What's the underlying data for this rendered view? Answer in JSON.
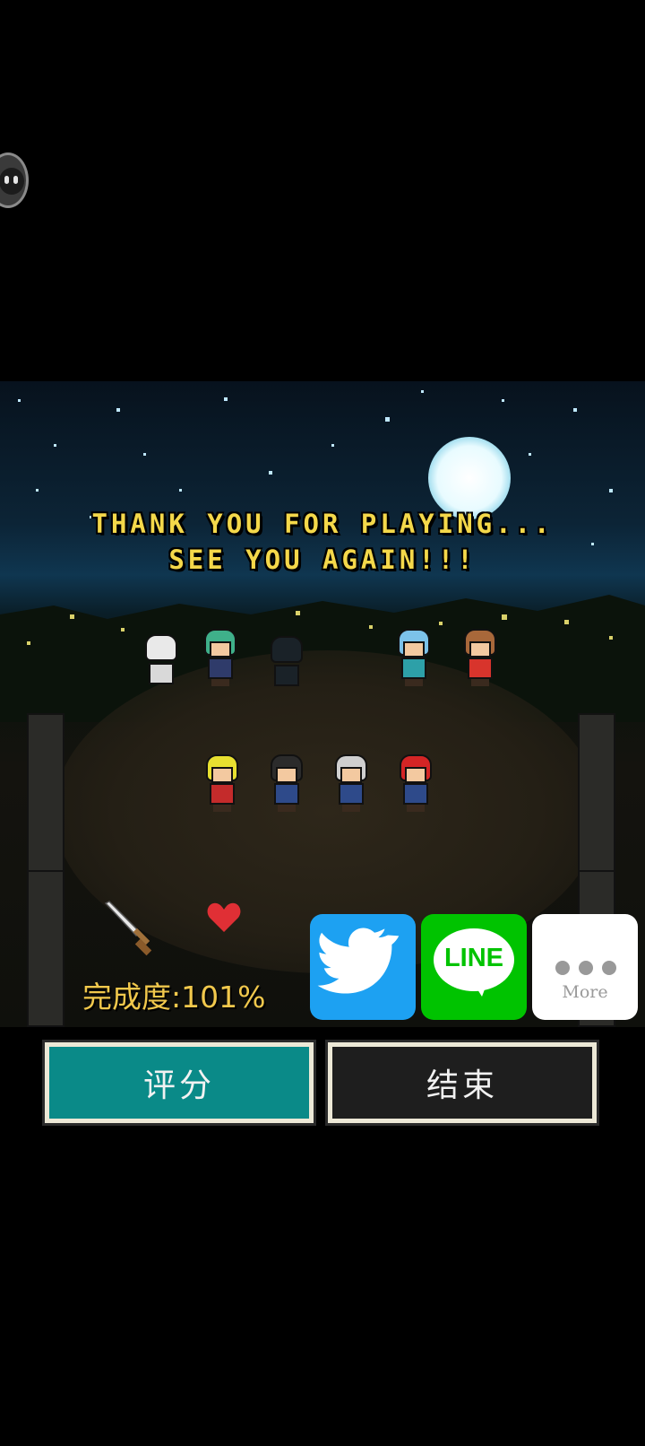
{
  "overlay": {
    "assistant_icon": "assistant-ball-icon"
  },
  "scene": {
    "message_line1": "THANK YOU FOR PLAYING...",
    "message_line2": "SEE YOU AGAIN!!!",
    "progress_text": "完成度:101%",
    "icons": [
      "sword-icon",
      "heart-icon",
      "moon-icon"
    ]
  },
  "share": {
    "twitter_icon": "twitter-bird-icon",
    "line_label": "LINE",
    "more_label": "More"
  },
  "buttons": {
    "rate_label": "评分",
    "end_label": "结束"
  },
  "colors": {
    "title_yellow": "#f4d84a",
    "rate_teal": "#0a8a88",
    "end_dark": "#1e1e1e",
    "twitter_blue": "#1da1f2",
    "line_green": "#00c300"
  }
}
